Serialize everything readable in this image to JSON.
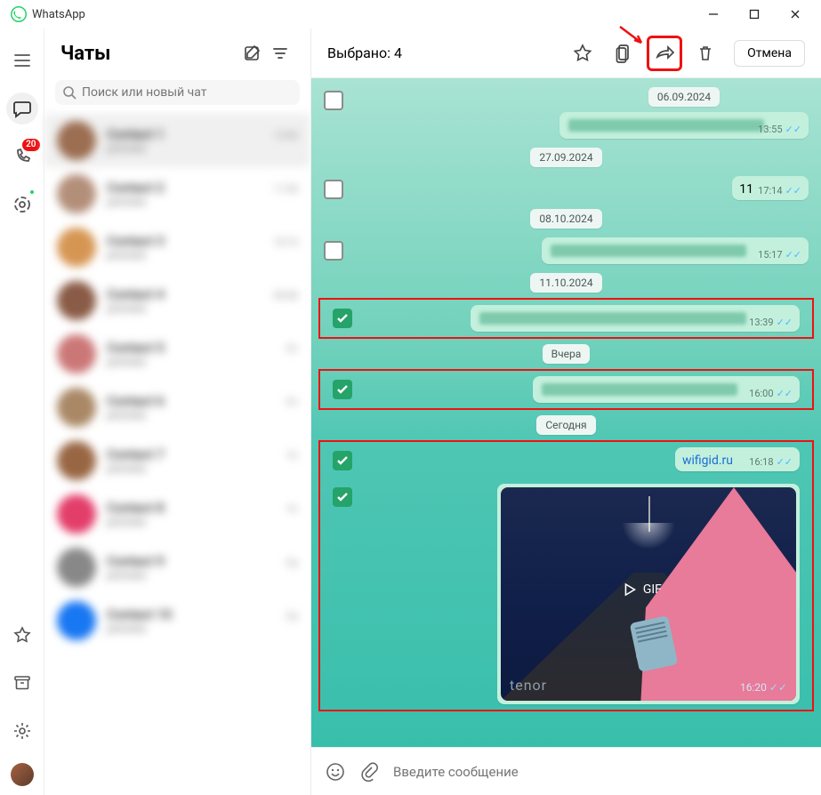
{
  "titlebar": {
    "app_name": "WhatsApp"
  },
  "rail": {
    "calls_badge": "20"
  },
  "sidebar": {
    "title": "Чаты",
    "search_placeholder": "Поиск или новый чат",
    "items": [
      {
        "name_hidden": "Contact 1",
        "preview_hidden": "preview",
        "time_hidden": "12:00"
      },
      {
        "name_hidden": "Contact 2",
        "preview_hidden": "preview",
        "time_hidden": "11:30"
      },
      {
        "name_hidden": "Contact 3",
        "preview_hidden": "preview",
        "time_hidden": "10:15"
      },
      {
        "name_hidden": "Contact 4",
        "preview_hidden": "preview",
        "time_hidden": "09:40"
      },
      {
        "name_hidden": "Contact 5",
        "preview_hidden": "preview",
        "time_hidden": "Пт"
      },
      {
        "name_hidden": "Contact 6",
        "preview_hidden": "preview",
        "time_hidden": "Пт"
      },
      {
        "name_hidden": "Contact 7",
        "preview_hidden": "preview",
        "time_hidden": "Чт"
      },
      {
        "name_hidden": "Contact 8",
        "preview_hidden": "preview",
        "time_hidden": "Чт"
      },
      {
        "name_hidden": "Contact 9",
        "preview_hidden": "preview",
        "time_hidden": "Ср"
      },
      {
        "name_hidden": "Contact 10",
        "preview_hidden": "preview",
        "time_hidden": "Ср"
      }
    ]
  },
  "header": {
    "selected_label": "Выбрано: 4",
    "cancel_label": "Отмена"
  },
  "dates": {
    "d1": "06.09.2024",
    "d2": "27.09.2024",
    "d3": "08.10.2024",
    "d4": "11.10.2024",
    "d5": "Вчера",
    "d6": "Сегодня"
  },
  "msgs": {
    "m1_time": "13:55",
    "m2_text": "11",
    "m2_time": "17:14",
    "m3_time": "15:17",
    "m4_time": "13:39",
    "m5_time": "16:00",
    "m6_link": "wifigid.ru",
    "m6_time": "16:18",
    "m7_gif_label": "GIF",
    "m7_watermark": "tenor",
    "m7_time": "16:20"
  },
  "composer": {
    "placeholder": "Введите сообщение"
  }
}
